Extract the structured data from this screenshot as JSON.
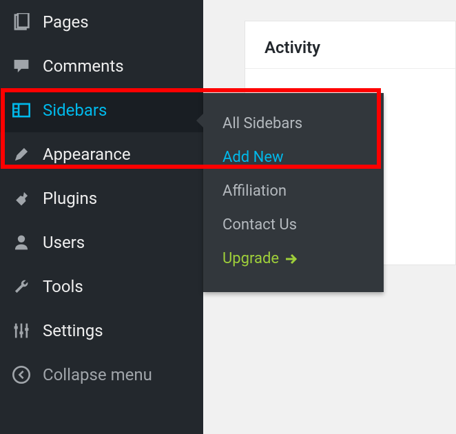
{
  "sidebar": {
    "items": [
      {
        "label": "Pages",
        "icon": "pages-icon",
        "active": false
      },
      {
        "label": "Comments",
        "icon": "comments-icon",
        "active": false
      },
      {
        "label": "Sidebars",
        "icon": "sidebars-icon",
        "active": true
      },
      {
        "label": "Appearance",
        "icon": "appearance-icon",
        "active": false
      },
      {
        "label": "Plugins",
        "icon": "plugins-icon",
        "active": false
      },
      {
        "label": "Users",
        "icon": "users-icon",
        "active": false
      },
      {
        "label": "Tools",
        "icon": "tools-icon",
        "active": false
      },
      {
        "label": "Settings",
        "icon": "settings-icon",
        "active": false
      }
    ],
    "collapse_label": "Collapse menu"
  },
  "submenu": {
    "items": [
      {
        "label": "All Sidebars",
        "style": "normal"
      },
      {
        "label": "Add New",
        "style": "current"
      },
      {
        "label": "Affiliation",
        "style": "normal"
      },
      {
        "label": "Contact Us",
        "style": "normal"
      },
      {
        "label": "Upgrade",
        "style": "upgrade"
      }
    ]
  },
  "content": {
    "card_title": "Activity"
  },
  "colors": {
    "sidebar_bg": "#23282d",
    "submenu_bg": "#32373c",
    "accent": "#00b9eb",
    "upgrade": "#9fcf3a",
    "highlight": "#ff0000"
  }
}
